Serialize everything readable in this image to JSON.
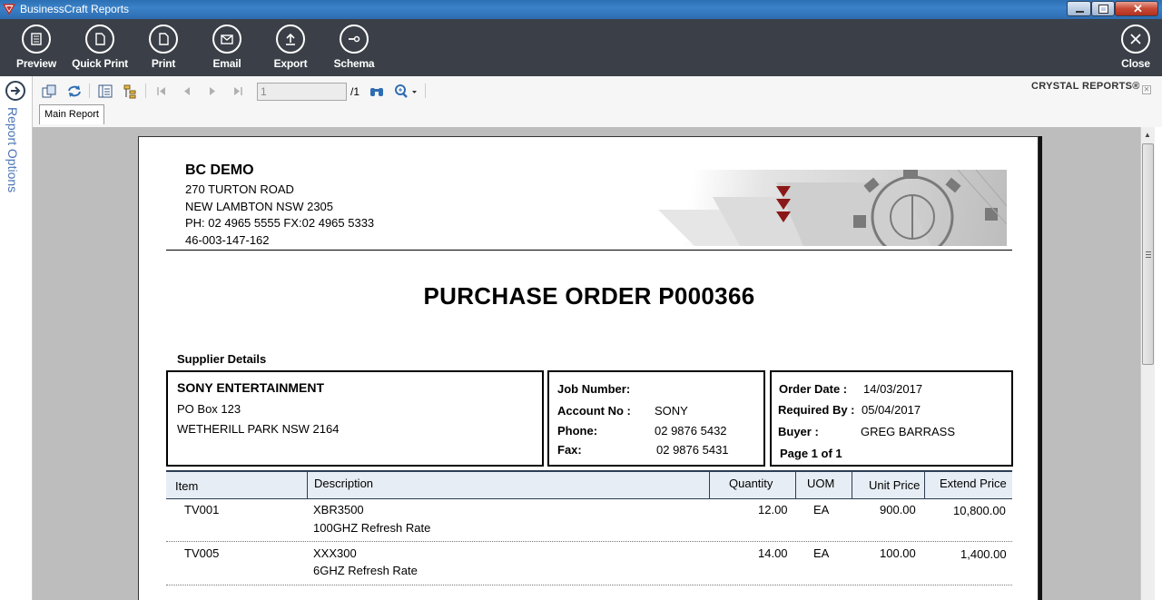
{
  "window": {
    "title": "BusinessCraft Reports"
  },
  "toolbar": {
    "buttons": [
      {
        "label": "Preview",
        "icon": "preview-icon"
      },
      {
        "label": "Quick Print",
        "icon": "quick-print-icon"
      },
      {
        "label": "Print",
        "icon": "print-icon"
      },
      {
        "label": "Email",
        "icon": "email-icon"
      },
      {
        "label": "Export",
        "icon": "export-icon"
      },
      {
        "label": "Schema",
        "icon": "schema-icon"
      }
    ],
    "close_label": "Close"
  },
  "left_panel": {
    "label": "Report Options"
  },
  "viewer": {
    "page_input": "1",
    "page_total": "/1",
    "brand": "CRYSTAL REPORTS®",
    "tab": "Main Report"
  },
  "report": {
    "company": {
      "name": "BC DEMO",
      "address1": "270 TURTON ROAD",
      "address2": "NEW LAMBTON NSW  2305",
      "phone_fax": "PH: 02  4965 5555 FX:02 4965 5333",
      "abn": "46-003-147-162"
    },
    "title": "PURCHASE ORDER  P000366",
    "supplier_label": "Supplier Details",
    "supplier": {
      "name": "SONY ENTERTAINMENT",
      "address1": "PO Box 123",
      "address2": "WETHERILL PARK  NSW 2164"
    },
    "job": {
      "job_number_label": "Job Number:",
      "job_number": "",
      "account_label": "Account No :",
      "account": "SONY",
      "phone_label": "Phone:",
      "phone": "02 9876 5432",
      "fax_label": "Fax:",
      "fax": "02 9876 5431"
    },
    "order": {
      "order_date_label": "Order Date :",
      "order_date": "14/03/2017",
      "required_label": "Required By :",
      "required": "05/04/2017",
      "buyer_label": "Buyer :",
      "buyer": "GREG BARRASS",
      "page": "Page 1 of 1"
    },
    "columns": [
      "Item",
      "Description",
      "Quantity",
      "UOM",
      "Unit Price",
      "Extend Price"
    ],
    "rows": [
      {
        "item": "TV001",
        "desc": "XBR3500",
        "desc2": "100GHZ Refresh Rate",
        "qty": "12.00",
        "uom": "EA",
        "unit": "900.00",
        "ext": "10,800.00"
      },
      {
        "item": "TV005",
        "desc": "XXX300",
        "desc2": "6GHZ Refresh Rate",
        "qty": "14.00",
        "uom": "EA",
        "unit": "100.00",
        "ext": "1,400.00"
      }
    ]
  }
}
